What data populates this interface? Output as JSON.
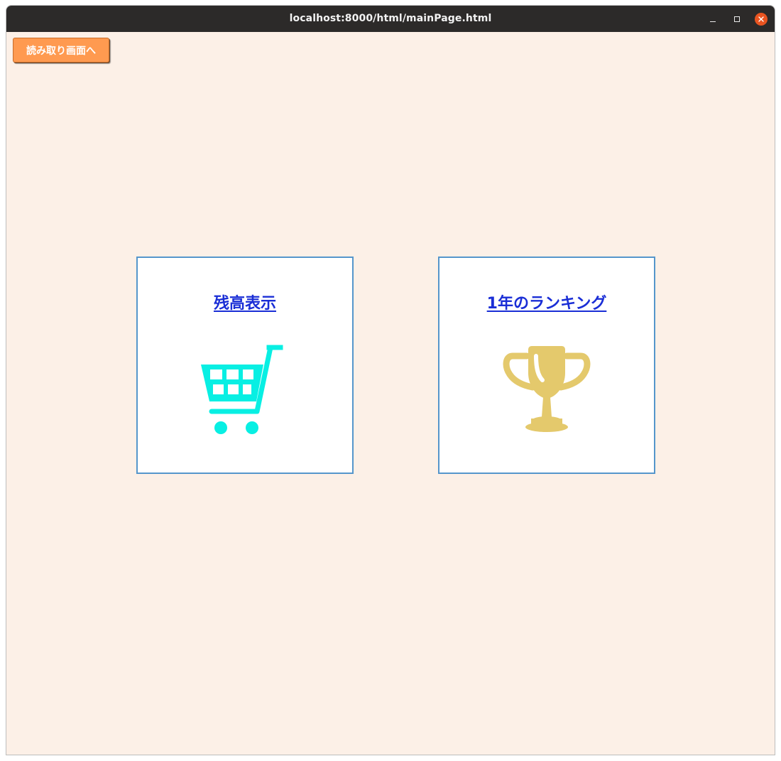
{
  "window": {
    "title": "localhost:8000/html/mainPage.html",
    "controls": {
      "minimize": "minimize-icon",
      "maximize": "maximize-icon",
      "close": "close-icon"
    }
  },
  "page": {
    "background_color": "#fcf0e7",
    "read_button": {
      "label": "読み取り画面へ",
      "color": "#ff9a50"
    },
    "cards": [
      {
        "label": "残高表示",
        "icon": "shopping-cart-icon",
        "icon_color": "#08efe3"
      },
      {
        "label": "1年のランキング",
        "icon": "trophy-icon",
        "icon_color": "#e4c96c"
      }
    ],
    "card_border_color": "#5596cb",
    "link_color": "#1a2ed6"
  }
}
